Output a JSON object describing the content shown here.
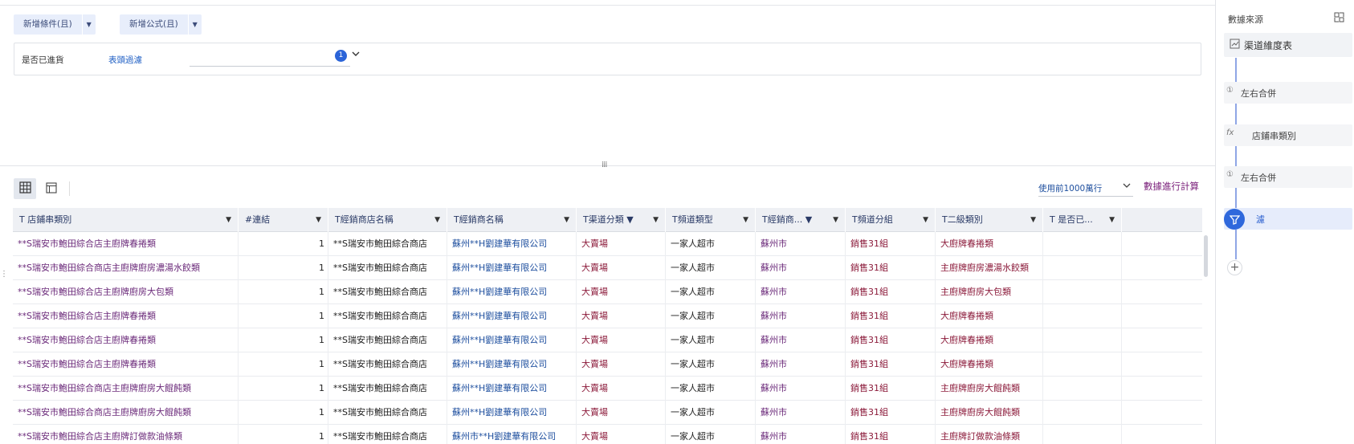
{
  "toolbar_top": {
    "add_condition": "新增條件(且)",
    "add_formula": "新增公式(且)"
  },
  "filter": {
    "field_label": "是否已進貨",
    "link_label": "表頭過濾",
    "badge_count": "1"
  },
  "grid_toolbar": {
    "rows_select": "使用前1000萬行",
    "calc_link": "數據進行計算"
  },
  "table": {
    "headers": [
      {
        "label": "T 店鋪串類別"
      },
      {
        "label": "#連結"
      },
      {
        "label": "T經銷商店名稱"
      },
      {
        "label": "T經銷商名稱"
      },
      {
        "label": "T渠道分類 ▼"
      },
      {
        "label": "T頻道類型"
      },
      {
        "label": "T經銷商... ▼"
      },
      {
        "label": "T頻道分組"
      },
      {
        "label": "T二級類別"
      },
      {
        "label": "T  是否已..."
      }
    ],
    "rows": [
      [
        "**S瑞安市鮑田綜合店主廚牌春捲類",
        "1",
        "**S瑞安市鮑田綜合商店",
        "蘇州**H劉建華有限公司",
        "大賣場",
        "一家人超市",
        "蘇州市",
        "銷售31組",
        "大廚牌春捲類",
        ""
      ],
      [
        "**S瑞安市鮑田綜合商店主廚牌廚房濃湯水餃類",
        "1",
        "**S瑞安市鮑田綜合商店",
        "蘇州**H劉建華有限公司",
        "大賣場",
        "一家人超市",
        "蘇州市",
        "銷售31組",
        "主廚牌廚房濃湯水餃類",
        ""
      ],
      [
        "**S瑞安市鮑田綜合店主廚牌廚房大包類",
        "1",
        "**S瑞安市鮑田綜合商店",
        "蘇州**H劉建華有限公司",
        "大賣場",
        "一家人超市",
        "蘇州市",
        "銷售31組",
        "主廚牌廚房大包類",
        ""
      ],
      [
        "**S瑞安市鮑田綜合店主廚牌春捲類",
        "1",
        "**S瑞安市鮑田綜合商店",
        "蘇州**H劉建華有限公司",
        "大賣場",
        "一家人超市",
        "蘇州市",
        "銷售31組",
        "大廚牌春捲類",
        ""
      ],
      [
        "**S瑞安市鮑田綜合店主廚牌春捲類",
        "1",
        "**S瑞安市鮑田綜合商店",
        "蘇州**H劉建華有限公司",
        "大賣場",
        "一家人超市",
        "蘇州市",
        "銷售31組",
        "大廚牌春捲類",
        ""
      ],
      [
        "**S瑞安市鮑田綜合店主廚牌春捲類",
        "1",
        "**S瑞安市鮑田綜合商店",
        "蘇州**H劉建華有限公司",
        "大賣場",
        "一家人超市",
        "蘇州市",
        "銷售31組",
        "大廚牌春捲類",
        ""
      ],
      [
        "**S瑞安市鮑田綜合商店主廚牌廚房大餛飩類",
        "1",
        "**S瑞安市鮑田綜合商店",
        "蘇州**H劉建華有限公司",
        "大賣場",
        "一家人超市",
        "蘇州市",
        "銷售31組",
        "主廚牌廚房大餛飩類",
        ""
      ],
      [
        "**S瑞安市鮑田綜合商店主廚牌廚房大餛飩類",
        "1",
        "**S瑞安市鮑田綜合商店",
        "蘇州**H劉建華有限公司",
        "大賣場",
        "一家人超市",
        "蘇州市",
        "銷售31組",
        "主廚牌廚房大餛飩類",
        ""
      ],
      [
        "**S瑞安市鮑田綜合店主廚牌訂做款油條類",
        "1",
        "**S瑞安市鮑田綜合商店",
        "蘇州市**H劉建華有限公司",
        "大賣場",
        "一家人超市",
        "蘇州市",
        "銷售31組",
        "主廚牌訂做款油條類",
        ""
      ]
    ]
  },
  "right_panel": {
    "title": "數據來源",
    "source_node": "渠道維度表",
    "steps": [
      {
        "label": "左右合併",
        "icon": "①"
      },
      {
        "label": "店鋪串類別",
        "icon": "fx"
      },
      {
        "label": "左右合併",
        "icon": "①"
      },
      {
        "label": "濾",
        "icon": "filter"
      }
    ]
  },
  "colors": {
    "accent": "#2f68dc",
    "header_bg": "#eef0f4",
    "link_blue": "#1d4e9e",
    "calc_purple": "#7a1f7a"
  }
}
